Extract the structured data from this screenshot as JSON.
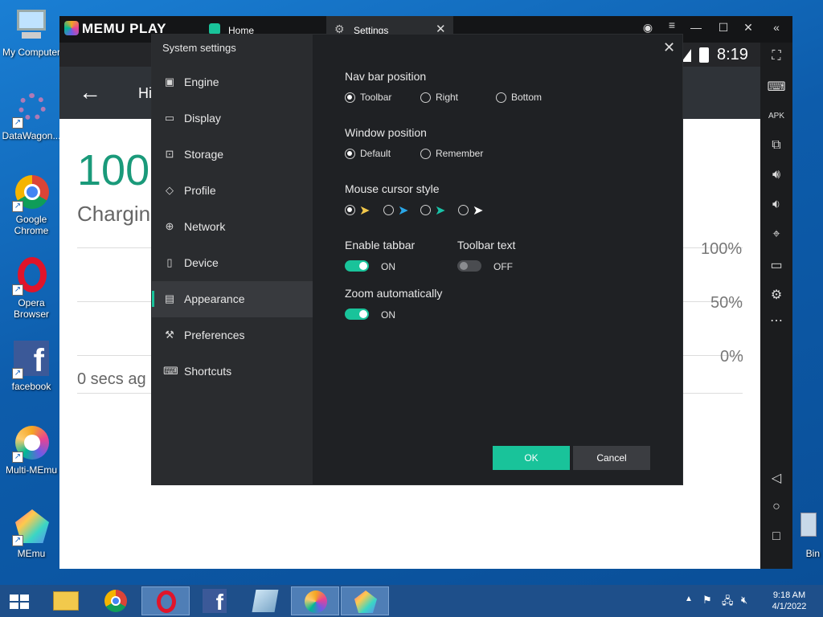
{
  "desktop": {
    "icons": [
      {
        "label": "My Computer"
      },
      {
        "label": "DataWagon..."
      },
      {
        "label": "Google Chrome"
      },
      {
        "label": "Opera Browser"
      },
      {
        "label": "facebook"
      },
      {
        "label": "Multi-MEmu"
      },
      {
        "label": "MEmu"
      }
    ],
    "recycle_bin_label": "Bin"
  },
  "emulator": {
    "logo": "MEMU PLAY",
    "tabs": [
      {
        "label": "Home"
      },
      {
        "label": "Settings"
      }
    ],
    "android": {
      "time": "8:19",
      "header_text": "Hi",
      "battery_percent": "100",
      "charging_text": "Chargin",
      "levels": [
        "100%",
        "50%",
        "0%"
      ],
      "updated_text": "0 secs ag"
    }
  },
  "dialog": {
    "title": "System settings",
    "nav": [
      {
        "label": "Engine",
        "icon": "chip-icon"
      },
      {
        "label": "Display",
        "icon": "monitor-icon"
      },
      {
        "label": "Storage",
        "icon": "disk-icon"
      },
      {
        "label": "Profile",
        "icon": "tag-icon"
      },
      {
        "label": "Network",
        "icon": "globe-icon"
      },
      {
        "label": "Device",
        "icon": "mic-icon"
      },
      {
        "label": "Appearance",
        "icon": "window-icon",
        "active": true
      },
      {
        "label": "Preferences",
        "icon": "wrench-icon"
      },
      {
        "label": "Shortcuts",
        "icon": "keyboard-icon"
      }
    ],
    "nav_bar_position": {
      "label": "Nav bar position",
      "options": [
        "Toolbar",
        "Right",
        "Bottom"
      ],
      "selected": "Toolbar"
    },
    "window_position": {
      "label": "Window position",
      "options": [
        "Default",
        "Remember"
      ],
      "selected": "Default"
    },
    "mouse_cursor_style": {
      "label": "Mouse cursor style",
      "options": [
        "yellow-cursor",
        "blue-cursor",
        "teal-cursor",
        "white-cursor"
      ],
      "selected": "yellow-cursor"
    },
    "enable_tabbar": {
      "label": "Enable tabbar",
      "state": "ON"
    },
    "toolbar_text": {
      "label": "Toolbar text",
      "state": "OFF"
    },
    "zoom_automatically": {
      "label": "Zoom automatically",
      "state": "ON"
    },
    "ok_label": "OK",
    "cancel_label": "Cancel",
    "accent_color": "#19c39a"
  },
  "taskbar": {
    "clock_time": "9:18 AM",
    "clock_date": "4/1/2022"
  }
}
